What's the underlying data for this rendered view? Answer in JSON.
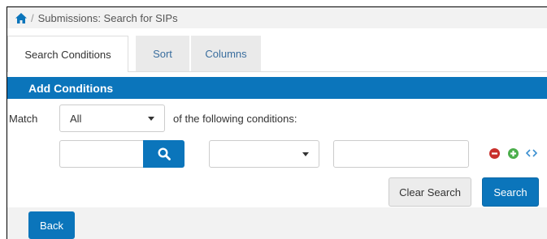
{
  "breadcrumb": {
    "separator": "/",
    "title": "Submissions: Search for SIPs"
  },
  "tabs": [
    {
      "label": "Search Conditions"
    },
    {
      "label": "Sort"
    },
    {
      "label": "Columns"
    }
  ],
  "conditions": {
    "header": "Add Conditions",
    "match_label": "Match",
    "match_value": "All",
    "following_label": "of the following conditions:",
    "field_value": "",
    "search_value": "",
    "value_text": ""
  },
  "buttons": {
    "clear": "Clear Search",
    "search": "Search",
    "back": "Back"
  },
  "colors": {
    "accent": "#0b75bb",
    "remove": "#c9302c",
    "add": "#4cae4c"
  }
}
